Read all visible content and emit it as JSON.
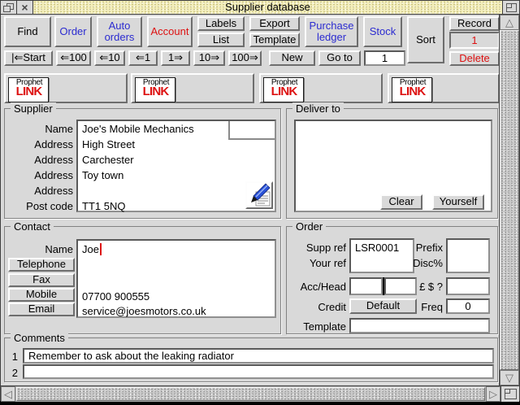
{
  "window": {
    "title": "Supplier database"
  },
  "colors": {
    "accent_blue": "#2b2bd0",
    "accent_red": "#dd1111",
    "titlebar_bg": "#f4efbb"
  },
  "icons": {
    "close": "×",
    "up": "△",
    "down": "▽",
    "left": "◁",
    "right": "▷"
  },
  "toolbar": {
    "find": "Find",
    "order": "Order",
    "auto_orders": "Auto orders",
    "account": "Account",
    "labels": "Labels",
    "list": "List",
    "export": "Export",
    "template": "Template",
    "purchase_ledger": "Purchase ledger",
    "stock": "Stock",
    "sort": "Sort",
    "record_label": "Record",
    "record_number": "1",
    "delete_label": "Delete"
  },
  "nav": {
    "start": "|⇐Start",
    "back_100": "⇐100",
    "back_10": "⇐10",
    "back_1": "⇐1",
    "fwd_1": "1⇒",
    "fwd_10": "10⇒",
    "fwd_100": "100⇒",
    "new_label": "New",
    "goto_label": "Go to",
    "goto_value": "1"
  },
  "prophet_link": {
    "line1": "Prophet",
    "line2": "LINK"
  },
  "supplier": {
    "title": "Supplier",
    "name_label": "Name",
    "address_label": "Address",
    "postcode_label": "Post code",
    "name": "Joe's Mobile Mechanics",
    "address1": "High Street",
    "address2": "Carchester",
    "address3": "Toy town",
    "address4": "",
    "postcode": "TT1 5NQ"
  },
  "deliver": {
    "title": "Deliver to",
    "address": "",
    "clear": "Clear",
    "yourself": "Yourself"
  },
  "contact": {
    "title": "Contact",
    "name_label": "Name",
    "name": "Joe",
    "telephone_label": "Telephone",
    "fax_label": "Fax",
    "mobile_label": "Mobile",
    "email_label": "Email",
    "telephone": "",
    "fax": "",
    "mobile": "07700 900555",
    "email": "service@joesmotors.co.uk"
  },
  "order": {
    "title": "Order",
    "supp_ref_label": "Supp ref",
    "supp_ref": "LSR0001",
    "your_ref_label": "Your ref",
    "your_ref": "",
    "prefix_label": "Prefix",
    "prefix": "",
    "disc_label": "Disc%",
    "disc": "",
    "acc_head_label": "Acc/Head",
    "acc": "",
    "head": "",
    "currency_label": "£ $ ?",
    "currency": "",
    "credit_label": "Credit",
    "credit_value": "Default",
    "freq_label": "Freq",
    "freq_value": "0",
    "template_label": "Template",
    "template_value": ""
  },
  "comments": {
    "title": "Comments",
    "rows": [
      {
        "num": "1",
        "text": "Remember to ask about the leaking radiator"
      },
      {
        "num": "2",
        "text": ""
      }
    ]
  }
}
